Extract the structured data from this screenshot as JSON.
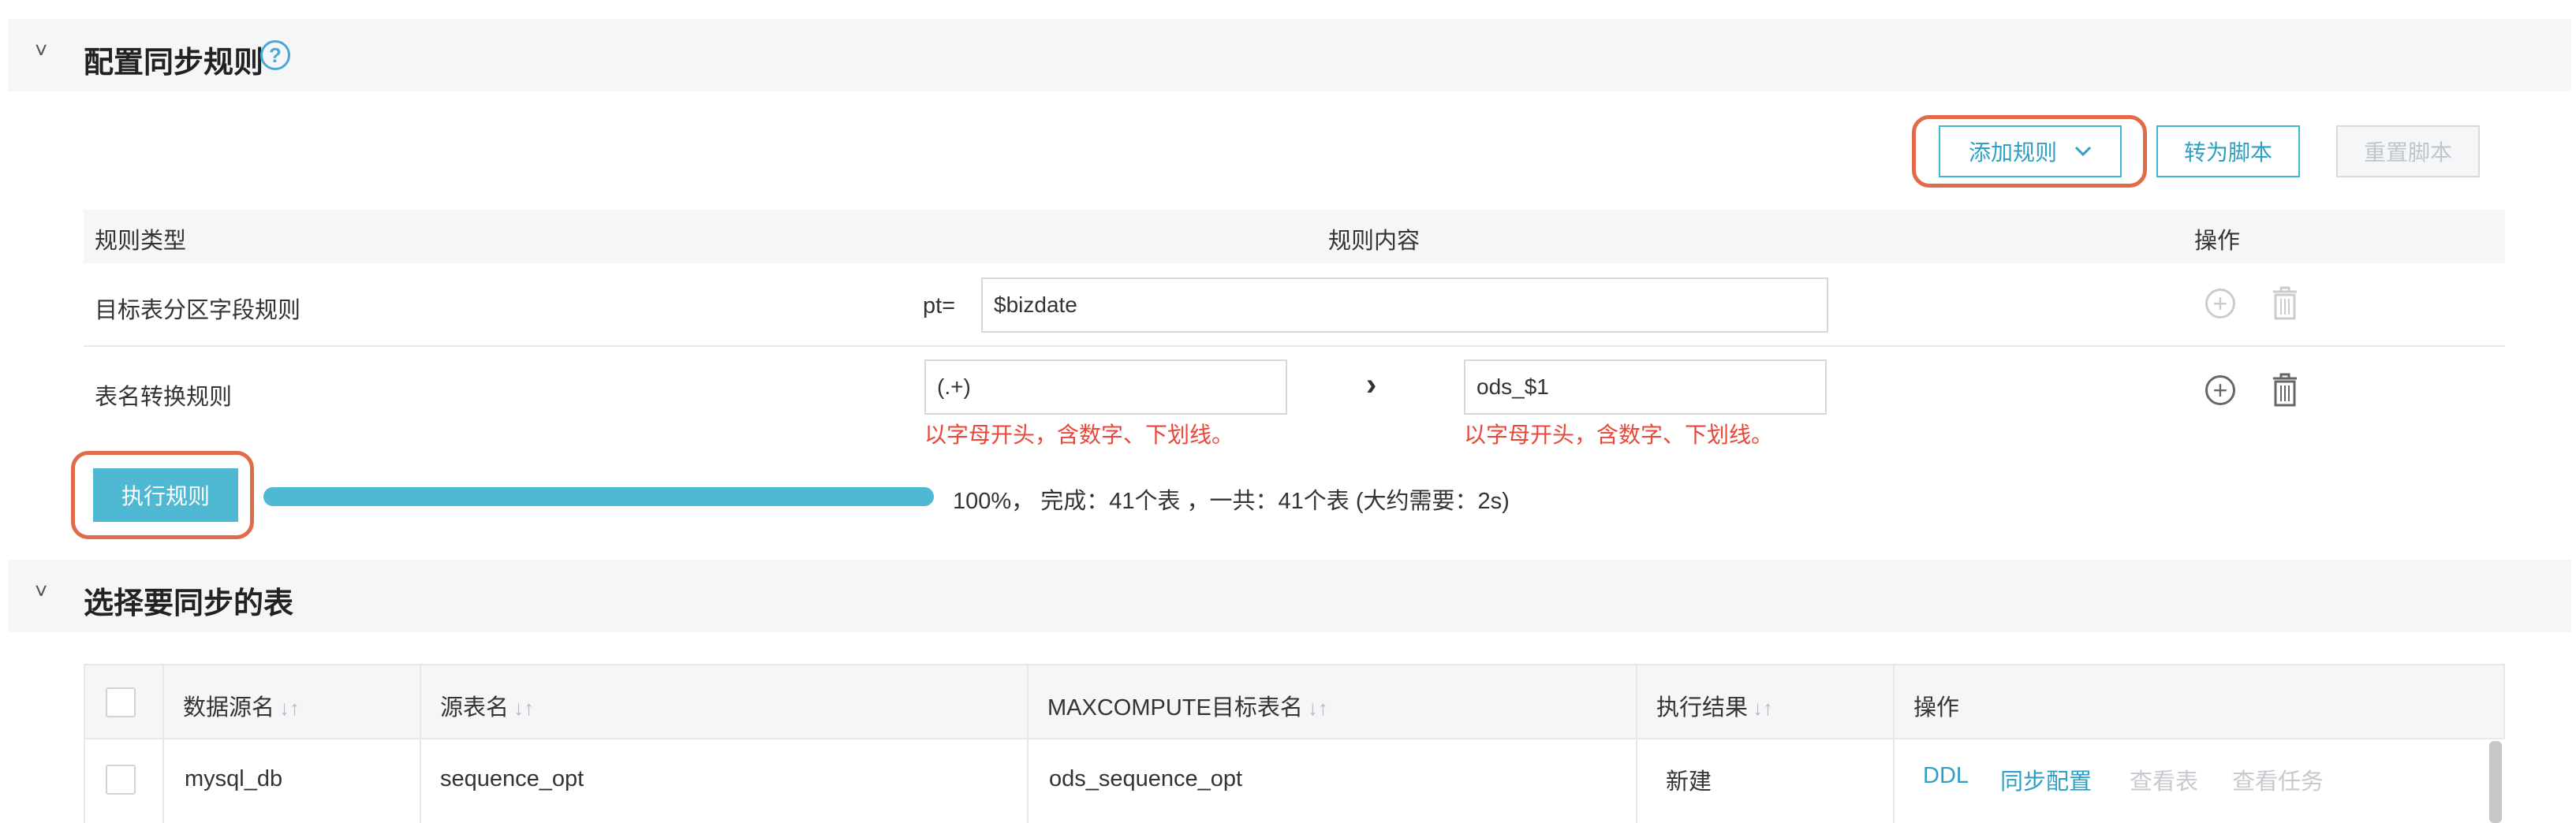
{
  "config_section": {
    "chevron": "˅",
    "title": "配置同步规则",
    "help_icon": "?"
  },
  "toolbar": {
    "add_rule_label": "添加规则",
    "to_script_label": "转为脚本",
    "reset_script_label": "重置脚本"
  },
  "rules_table": {
    "headers": {
      "type": "规则类型",
      "content": "规则内容",
      "action": "操作"
    },
    "rows": [
      {
        "type": "目标表分区字段规则",
        "prefix": "pt=",
        "value": "$bizdate"
      },
      {
        "type": "表名转换规则",
        "source_value": "(.+)",
        "arrow": "›",
        "target_value": "ods_$1",
        "source_hint": "以字母开头，含数字、下划线。",
        "target_hint": "以字母开头，含数字、下划线。"
      }
    ]
  },
  "execute": {
    "button_label": "执行规则",
    "progress_percent": 100,
    "status_text": "100%， 完成：41个表 ，一共：41个表 (大约需要：2s)"
  },
  "tables_section": {
    "chevron": "˅",
    "title": "选择要同步的表",
    "headers": {
      "datasource": "数据源名",
      "source_table": "源表名",
      "target_table": "MAXCOMPUTE目标表名",
      "result": "执行结果",
      "action": "操作"
    },
    "sort_icon": "↓↑",
    "rows": [
      {
        "datasource": "mysql_db",
        "source_table": "sequence_opt",
        "target_table": "ods_sequence_opt",
        "result": "新建",
        "actions": {
          "ddl": "DDL",
          "sync_config": "同步配置",
          "view_table": "查看表",
          "view_task": "查看任务"
        }
      }
    ]
  },
  "colors": {
    "accent": "#4fb8d3",
    "link": "#2f9fc4",
    "error": "#e8473a",
    "highlight": "#e06a4a"
  }
}
